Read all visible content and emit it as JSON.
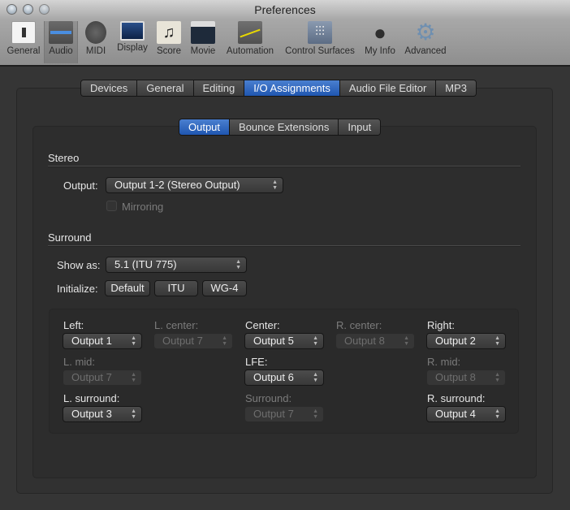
{
  "window": {
    "title": "Preferences"
  },
  "toolbar": [
    {
      "label": "General",
      "icon": "switch-icon"
    },
    {
      "label": "Audio",
      "icon": "waveform-icon",
      "selected": true
    },
    {
      "label": "MIDI",
      "icon": "midi-connector-icon"
    },
    {
      "label": "Display",
      "icon": "monitor-icon"
    },
    {
      "label": "Score",
      "icon": "music-notes-icon"
    },
    {
      "label": "Movie",
      "icon": "clapperboard-icon"
    },
    {
      "label": "Automation",
      "icon": "automation-curve-icon"
    },
    {
      "label": "Control Surfaces",
      "icon": "faders-icon"
    },
    {
      "label": "My Info",
      "icon": "person-icon"
    },
    {
      "label": "Advanced",
      "icon": "gear-icon"
    }
  ],
  "tabs": [
    "Devices",
    "General",
    "Editing",
    "I/O Assignments",
    "Audio File Editor",
    "MP3"
  ],
  "active_tab": "I/O Assignments",
  "subtabs": [
    "Output",
    "Bounce Extensions",
    "Input"
  ],
  "active_subtab": "Output",
  "stereo": {
    "heading": "Stereo",
    "output_label": "Output:",
    "output_value": "Output 1-2 (Stereo Output)",
    "mirroring_label": "Mirroring",
    "mirroring_checked": false
  },
  "surround": {
    "heading": "Surround",
    "show_as_label": "Show as:",
    "show_as_value": "5.1 (ITU 775)",
    "initialize_label": "Initialize:",
    "init_buttons": [
      "Default",
      "ITU",
      "WG-4"
    ],
    "channels": [
      {
        "label": "Left:",
        "value": "Output 1",
        "enabled": true
      },
      {
        "label": "L. center:",
        "value": "Output 7",
        "enabled": false
      },
      {
        "label": "Center:",
        "value": "Output 5",
        "enabled": true
      },
      {
        "label": "R. center:",
        "value": "Output 8",
        "enabled": false
      },
      {
        "label": "Right:",
        "value": "Output 2",
        "enabled": true
      },
      {
        "label": "L. mid:",
        "value": "Output 7",
        "enabled": false
      },
      {
        "label": "LFE:",
        "value": "Output 6",
        "enabled": true
      },
      {
        "label": "R. mid:",
        "value": "Output 8",
        "enabled": false
      },
      {
        "label": "L. surround:",
        "value": "Output 3",
        "enabled": true
      },
      {
        "label": "Surround:",
        "value": "Output 7",
        "enabled": false
      },
      {
        "label": "R. surround:",
        "value": "Output 4",
        "enabled": true
      }
    ]
  }
}
